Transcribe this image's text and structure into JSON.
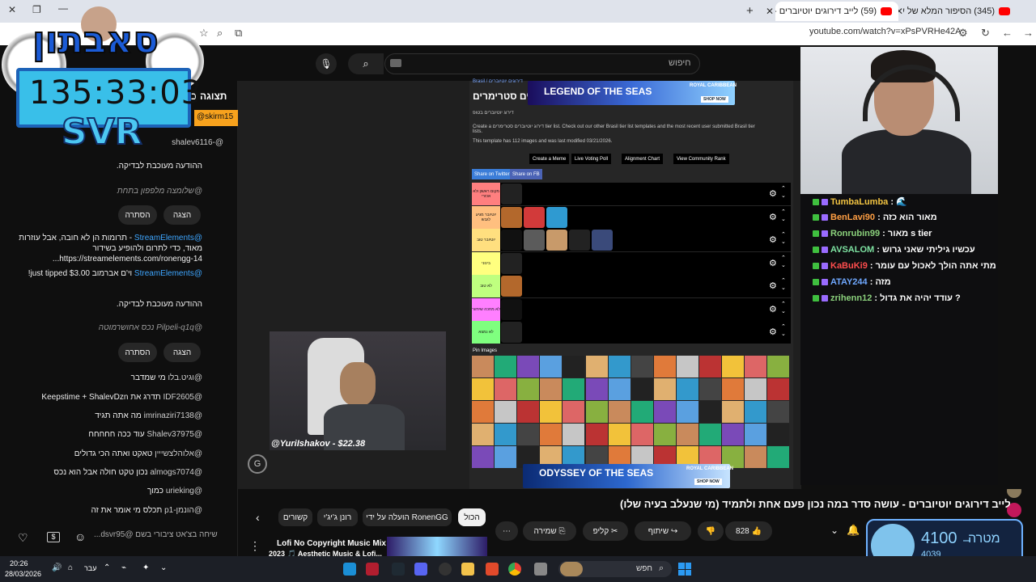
{
  "browser": {
    "tabs": [
      {
        "title": "(345) הסיפור המלא של עידן חב",
        "active": false
      },
      {
        "title": "(59) לייב דירוגים יוטיוברים - עוש",
        "active": true
      }
    ],
    "url": "youtube.com/watch?v=xPsPVRHe42A"
  },
  "overlay": {
    "brand": "סאבתון",
    "timer": "135:33:03",
    "tag": "SVR"
  },
  "youtube_header": {
    "search_placeholder": "חיפוש"
  },
  "live_chat": {
    "header_title": "תצוגה ב",
    "pinned_user": "@skirm15",
    "messages": [
      {
        "user": "@-shalev6116",
        "text": ""
      },
      {
        "user": "",
        "text": "ההודעה מעוכבת לבדיקה.",
        "type": "held"
      },
      {
        "user": "@שלומצה",
        "text": "מלפפון בתחת",
        "type": "held-preview"
      },
      {
        "user": "",
        "text": "",
        "type": "actions",
        "show": "הצגה",
        "hide": "הסתרה"
      },
      {
        "user": "@StreamElements",
        "text": "- תרומות הן לא חובה, אבל עוזרות מאוד, כדי לתרום ולהופיע בשידור https://streamelements.com/ronengg-14...",
        "type": "bot"
      },
      {
        "user": "@StreamElements",
        "text": "וי'ם אברמוב just tipped $3.00!",
        "type": "bot"
      },
      {
        "user": "",
        "text": "ההודעה מעוכבת לבדיקה.",
        "type": "held"
      },
      {
        "user": "@Pilpeli-q1q",
        "text": "נכס אחושרמוטה",
        "type": "held-preview"
      },
      {
        "user": "",
        "text": "",
        "type": "actions",
        "show": "הצגה",
        "hide": "הסתרה"
      },
      {
        "user": "@וגיט.בלו",
        "text": "מי שמדבר"
      },
      {
        "user": "@IDF2605",
        "text": "תדרג את Keepstime + ShalevDzn"
      },
      {
        "user": "@imrinaziri7138",
        "text": "מה אתה תגיד"
      },
      {
        "user": "@Shalev37975",
        "text": "עוד ככה חחחחח"
      },
      {
        "user": "@אלוהלצשייין",
        "text": "טאקט ואתה הכי גדולים"
      },
      {
        "user": "@almogs7074",
        "text": "נכון טקט חולה אבל הוא נכס"
      },
      {
        "user": "@urieking",
        "text": "כמוך"
      },
      {
        "user": "@הונמן-p1",
        "text": "תכלס מי אומר את זה"
      }
    ],
    "input_placeholder": "שיחה בצ'אט ציבורי בשם @dsvr95..."
  },
  "tierlist": {
    "breadcrumb": "Brasil / דירוגים יוטיוברים",
    "title": "דירוג יוטיוברים סטרימרים",
    "subtitle": "דירוג יוטיוברים בטופ",
    "description": "Create a דירוג יוטיוברים סטרימרים tier list. Check out our other Brasil tier list templates and the most recent user submitted Brasil tier lists.",
    "template_info": "This template has 112 images and was last modified 03/21/2026.",
    "buttons": [
      "Create a Meme",
      "Live Voting Poll",
      "Alignment Chart",
      "View Community Rank"
    ],
    "share": [
      "Share on Twitter",
      "Share on FB"
    ],
    "tiers": [
      {
        "label": "מקום ראשון ולא אכזרי",
        "color": "#ff7f7f",
        "items": 1
      },
      {
        "label": "יוטיובר מגיע לגבש",
        "color": "#ffbf7f",
        "items": 3
      },
      {
        "label": "יוטיובר טוב",
        "color": "#ffdf7f",
        "items": 5
      },
      {
        "label": "בינוני",
        "color": "#ffff7f",
        "items": 1
      },
      {
        "label": "לא טוב",
        "color": "#bfff7f",
        "items": 1
      },
      {
        "label": "לא מחכה שיחזור",
        "color": "#ff7fff",
        "items": 1
      },
      {
        "label": "לא נמצא",
        "color": "#7fff7f",
        "items": 1
      }
    ],
    "pool_label": "Pin Images"
  },
  "ads": [
    {
      "text": "LEGEND OF THE SEAS",
      "brand": "ROYAL CARIBBEAN",
      "cta": "SHOP NOW"
    },
    {
      "text": "ODYSSEY OF THE SEAS",
      "brand": "ROYAL CARIBBEAN",
      "cta": "SHOP NOW"
    }
  ],
  "donation_alert": "@YuriIshakov - $22.38",
  "video": {
    "title": "לייב דירוגים יוטיוברים - עושה סדר במה נכון פעם אחת ולתמיד (מי שנעלב בעיה שלו)",
    "like_count": "828",
    "actions": {
      "share": "שיתוף",
      "clip": "קליפ",
      "save": "שמירה"
    }
  },
  "related_chips": [
    "הכול",
    "הועלה על ידי RonenGG",
    "רונן ג'יג'י",
    "קשורים"
  ],
  "recommended": {
    "title": "Lofi No Copyright Music Mix",
    "subtitle": "2023 🎵 Aesthetic Music & Lofi..."
  },
  "twitch_chat": [
    {
      "user": "TumbaLumba",
      "text": "🌊",
      "color": "#f4c542"
    },
    {
      "user": "BenLavi90",
      "text": "מאור הוא כזה",
      "color": "#ff9f43"
    },
    {
      "user": "Ronrubin99",
      "text": "מאור s tier",
      "color": "#8bd17c"
    },
    {
      "user": "AVSALOM",
      "text": "עכשיו גיליתי שאני גרוש",
      "color": "#7ee3a2"
    },
    {
      "user": "KaBuKi9",
      "text": "עודד מתי אתה הולך לאכול עם עומר ??",
      "color": "#ff4d4d"
    },
    {
      "user": "ATAY244",
      "text": "מזה",
      "color": "#6fa8ff"
    },
    {
      "user": "zrihenn12",
      "text": "עודד יהיה את גדול ?",
      "color": "#8bd17c"
    }
  ],
  "goal": {
    "label": "מטרה",
    "target": "4100",
    "current": "4039",
    "progress": 0.985
  },
  "taskbar": {
    "search": "חפש",
    "time": "20:26",
    "date": "28/03/2026",
    "language": "עבר"
  },
  "colors": {
    "youtube_bg": "#0f0f0f",
    "accent_blue": "#3ea6ff",
    "goal_blue": "#8fd3ff"
  }
}
